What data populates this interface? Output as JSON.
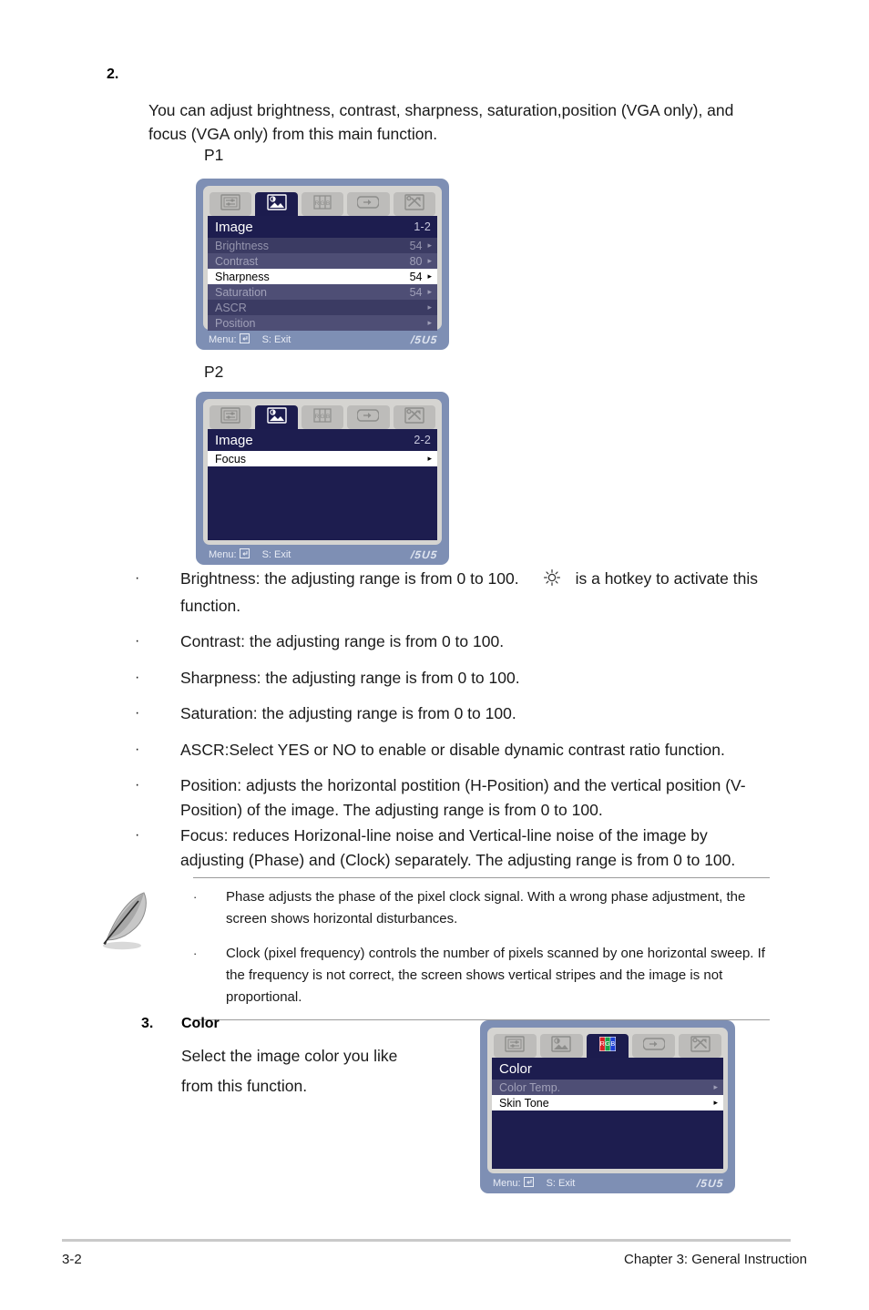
{
  "step2": {
    "number": "2.",
    "paragraph": "You can adjust brightness, contrast, sharpness, saturation,position (VGA only), and focus (VGA only) from  this main function.",
    "p1_label": "P1",
    "p2_label": "P2"
  },
  "osd_p1": {
    "tabs": [
      {
        "name": "system-setup-icon",
        "active": false
      },
      {
        "name": "image-icon",
        "active": true
      },
      {
        "name": "rgb-color-icon",
        "active": false
      },
      {
        "name": "input-select-icon",
        "active": false
      },
      {
        "name": "tools-icon",
        "active": false
      }
    ],
    "title": "Image",
    "page_indicator": "1-2",
    "rows": [
      {
        "label": "Brightness",
        "value": "54",
        "arrow": "▸",
        "state": "dim-a"
      },
      {
        "label": "Contrast",
        "value": "80",
        "arrow": "▸",
        "state": "dim-b"
      },
      {
        "label": "Sharpness",
        "value": "54",
        "arrow": "▸",
        "state": "sel"
      },
      {
        "label": "Saturation",
        "value": "54",
        "arrow": "▸",
        "state": "dim-b"
      },
      {
        "label": "ASCR",
        "value": "",
        "arrow": "▸",
        "state": "dim-a"
      },
      {
        "label": "Position",
        "value": "",
        "arrow": "▸",
        "state": "dim-b"
      }
    ],
    "footer": {
      "menu_label": "Menu:",
      "menu_key": "↵",
      "exit_label": "S: Exit",
      "brand": "/5U5"
    }
  },
  "osd_p2": {
    "tabs": [
      {
        "name": "system-setup-icon",
        "active": false
      },
      {
        "name": "image-icon",
        "active": true
      },
      {
        "name": "rgb-color-icon",
        "active": false
      },
      {
        "name": "input-select-icon",
        "active": false
      },
      {
        "name": "tools-icon",
        "active": false
      }
    ],
    "title": "Image",
    "page_indicator": "2-2",
    "rows": [
      {
        "label": "Focus",
        "value": "",
        "arrow": "▸",
        "state": "sel"
      }
    ],
    "footer": {
      "menu_label": "Menu:",
      "menu_key": "↵",
      "exit_label": "S: Exit",
      "brand": "/5U5"
    }
  },
  "osd_color": {
    "tabs": [
      {
        "name": "system-setup-icon",
        "active": false
      },
      {
        "name": "image-icon",
        "active": false
      },
      {
        "name": "rgb-color-icon",
        "active": true
      },
      {
        "name": "input-select-icon",
        "active": false
      },
      {
        "name": "tools-icon",
        "active": false
      }
    ],
    "title": "Color",
    "page_indicator": "",
    "rows": [
      {
        "label": "Color Temp.",
        "value": "",
        "arrow": "▸",
        "state": "dim-b"
      },
      {
        "label": "Skin Tone",
        "value": "",
        "arrow": "▸",
        "state": "sel"
      }
    ],
    "footer": {
      "menu_label": "Menu:",
      "menu_key": "↵",
      "exit_label": "S: Exit",
      "brand": "/5U5"
    }
  },
  "bullets": [
    {
      "marker": "·",
      "text_before": "Brightness: the adjusting range is from 0 to 100.",
      "icon": "sun-brightness-icon",
      "text_after": "is a hotkey to activate this function."
    },
    {
      "marker": "·",
      "text": "Contrast: the adjusting range is from 0 to 100."
    },
    {
      "marker": "·",
      "text": "Sharpness: the adjusting range is from 0 to 100."
    },
    {
      "marker": "·",
      "text": "Saturation: the adjusting range is from 0 to 100."
    },
    {
      "marker": "·",
      "text": "ASCR:Select YES or NO to enable or disable dynamic contrast ratio function."
    },
    {
      "marker": "·",
      "text": "Position: adjusts the horizontal postition (H-Position) and the vertical position (V-Position) of the image. The adjusting range is from 0 to 100."
    },
    {
      "marker": "·",
      "text": "Focus: reduces Horizonal-line noise and Vertical-line noise of the image by adjusting (Phase) and (Clock) separately. The adjusting range is from 0 to 100."
    }
  ],
  "note": {
    "icon": "quill-pen-icon",
    "items": [
      {
        "marker": "·",
        "text": "Phase adjusts the phase of the pixel clock signal. With a wrong phase adjustment, the screen shows  horizontal disturbances."
      },
      {
        "marker": "·",
        "text": "Clock (pixel frequency) controls the number of pixels scanned by one horizontal sweep. If the frequency is not correct, the screen shows vertical stripes and the image is not proportional."
      }
    ]
  },
  "step3": {
    "number": "3.",
    "heading": "Color",
    "line1": "Select the image color you like",
    "line2": "from this function."
  },
  "footer": {
    "page_number": "3-2",
    "chapter": "Chapter 3: General Instruction"
  }
}
